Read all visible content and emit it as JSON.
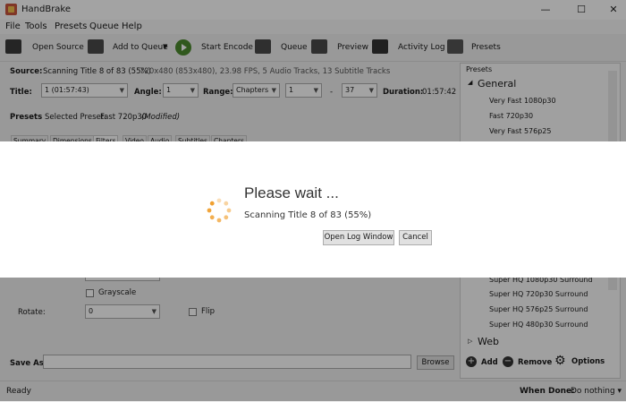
{
  "window": {
    "title": "HandBrake",
    "minimize": "—",
    "maximize": "☐",
    "close": "✕"
  },
  "menu": [
    "File",
    "Tools",
    "Presets",
    "Queue",
    "Help"
  ],
  "toolbar": {
    "open_source": "Open Source",
    "add_to_queue": "Add to Queue",
    "start_encode": "Start Encode",
    "queue": "Queue",
    "preview": "Preview",
    "activity_log": "Activity Log",
    "presets": "Presets"
  },
  "source": {
    "label": "Source:",
    "scanning": "Scanning Title 8 of 83 (55%)",
    "details": "720x480 (853x480), 23.98 FPS, 5 Audio Tracks, 13 Subtitle Tracks"
  },
  "title_row": {
    "title_label": "Title:",
    "title_value": "1 (01:57:43)",
    "angle_label": "Angle:",
    "angle_value": "1",
    "range_label": "Range:",
    "range_type": "Chapters",
    "range_start": "1",
    "range_sep": "-",
    "range_end": "37",
    "duration_label": "Duration:",
    "duration_value": "01:57:42"
  },
  "presets_row": {
    "label": "Presets",
    "selected_label": "Selected Preset:",
    "selected_value": "Fast 720p30",
    "modified": "(Modified)"
  },
  "tabs": [
    "Summary",
    "Dimensions",
    "Filters",
    "Video",
    "Audio",
    "Subtitles",
    "Chapters"
  ],
  "filters": {
    "grayscale": "Grayscale",
    "rotate_label": "Rotate:",
    "rotate_value": "0",
    "flip": "Flip"
  },
  "save_as": {
    "label": "Save As:",
    "value": "",
    "browse": "Browse"
  },
  "status": {
    "text": "Ready",
    "when_done_label": "When Done:",
    "when_done_value": "Do nothing ▾"
  },
  "preset_panel": {
    "header": "Presets",
    "general_group": "General",
    "general_items": [
      "Very Fast 1080p30",
      "Fast 720p30",
      "Very Fast 576p25"
    ],
    "surround_items": [
      "Super HQ 1080p30 Surround",
      "Super HQ 720p30 Surround",
      "Super HQ 576p25 Surround",
      "Super HQ 480p30 Surround"
    ],
    "web_group": "Web",
    "add": "Add",
    "remove": "Remove",
    "options": "Options"
  },
  "dialog": {
    "title": "Please wait ...",
    "status": "Scanning Title 8 of 83 (55%)",
    "open_log": "Open Log Window",
    "cancel": "Cancel"
  },
  "colors": {
    "accent_play": "#4b8a2e",
    "spinner": "#f0a030",
    "dim_overlay": "#000000"
  }
}
